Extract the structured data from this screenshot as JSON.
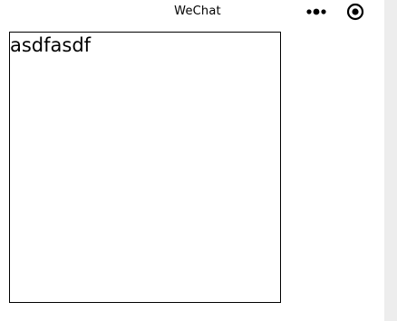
{
  "nav": {
    "title": "WeChat",
    "more_icon": "more-dots-icon",
    "close_icon": "target-close-icon"
  },
  "content": {
    "text": "asdfasdf"
  },
  "colors": {
    "background": "#ffffff",
    "gutter": "#ededed",
    "text": "#000000",
    "border": "#000000"
  }
}
